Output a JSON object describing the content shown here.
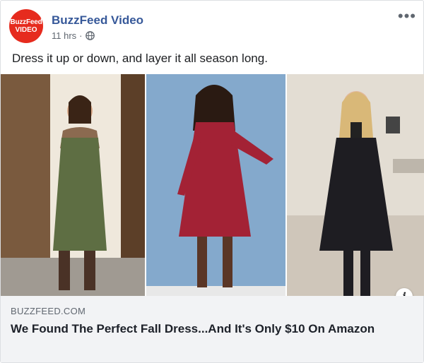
{
  "post": {
    "page_name": "BuzzFeed Video",
    "avatar_line1": "BuzzFeed",
    "avatar_line2": "VIDEO",
    "time": "11 hrs",
    "separator": "·",
    "more_label": "•••",
    "caption": "Dress it up or down, and layer it all season long.",
    "info_label": "i"
  },
  "link": {
    "domain": "BUZZFEED.COM",
    "title": "We Found The Perfect Fall Dress...And It's Only $10 On Amazon"
  },
  "colors": {
    "brand_red": "#e62b1e",
    "page_name_blue": "#365899",
    "link_bg": "#f2f3f5"
  }
}
